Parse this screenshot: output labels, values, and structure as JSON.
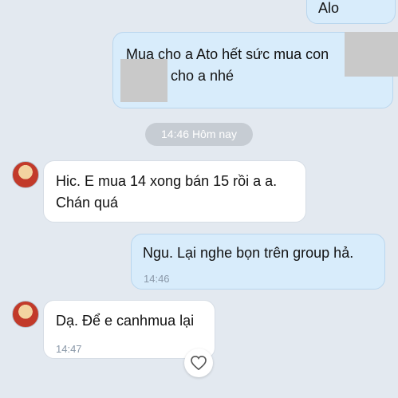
{
  "messages": [
    {
      "side": "out",
      "text": "Alo"
    },
    {
      "side": "out",
      "line1": "Mua cho a Ato hết sức mua con",
      "line2": "cho a nhé"
    },
    {
      "side": "in",
      "line1": "Hic. E mua 14 xong bán 15 rồi a a.",
      "line2": "Chán quá"
    },
    {
      "side": "out",
      "text": "Ngu. Lại nghe bọn trên group hả.",
      "time": "14:46"
    },
    {
      "side": "in",
      "text": "Dạ. Để e canhmua lại",
      "time": "14:47"
    }
  ],
  "date_separator": "14:46 Hôm nay",
  "icons": {
    "avatar": "tiger-avatar-icon",
    "reaction": "heart-outline-icon"
  },
  "colors": {
    "background": "#e3e9f0",
    "outgoing": "#d8ecfb",
    "incoming": "#ffffff"
  }
}
